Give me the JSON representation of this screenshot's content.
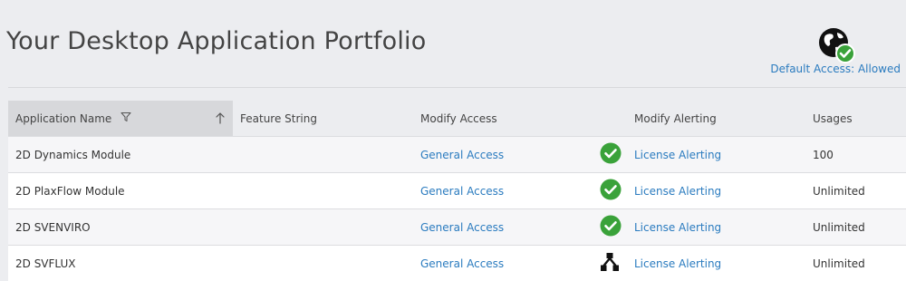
{
  "header": {
    "title": "Your Desktop Application Portfolio",
    "default_access_label": "Default Access: Allowed",
    "globe_icon": "globe-check-icon"
  },
  "table": {
    "columns": [
      "Application Name",
      "Feature String",
      "Modify Access",
      "",
      "Modify Alerting",
      "Usages"
    ],
    "rows": [
      {
        "application_name": "2D Dynamics Module",
        "feature_string": "",
        "access": "General Access",
        "status_icon": "green-check-icon",
        "alerting": "License Alerting",
        "usages": "100"
      },
      {
        "application_name": "2D PlaxFlow Module",
        "feature_string": "",
        "access": "General Access",
        "status_icon": "green-check-icon",
        "alerting": "License Alerting",
        "usages": "Unlimited"
      },
      {
        "application_name": "2D SVENVIRO",
        "feature_string": "",
        "access": "General Access",
        "status_icon": "green-check-icon",
        "alerting": "License Alerting",
        "usages": "Unlimited"
      },
      {
        "application_name": "2D SVFLUX",
        "feature_string": "",
        "access": "General Access",
        "status_icon": "hierarchy-icon",
        "alerting": "License Alerting",
        "usages": "Unlimited"
      }
    ]
  },
  "colors": {
    "link": "#2a7bbf",
    "check_green": "#3aa23a",
    "background": "#ecedf0",
    "sorted_header": "#d7d8db"
  }
}
